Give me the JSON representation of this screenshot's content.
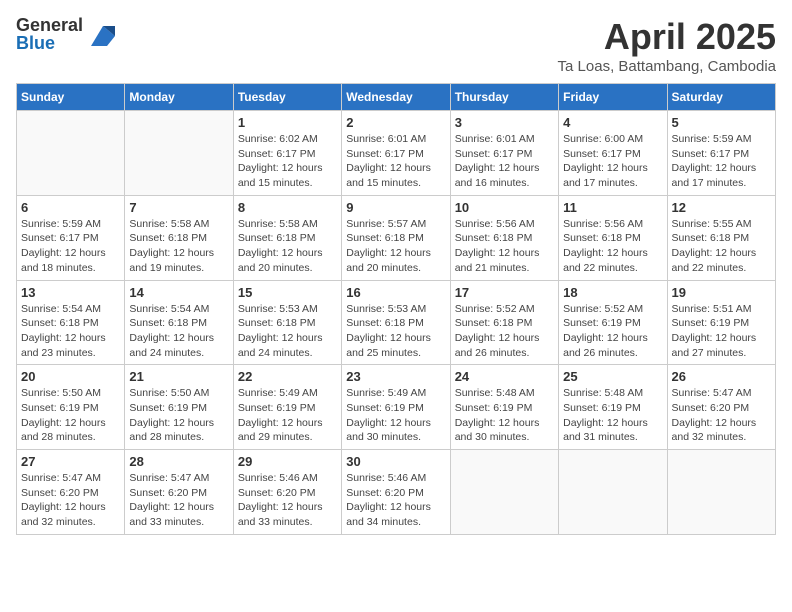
{
  "logo": {
    "general": "General",
    "blue": "Blue"
  },
  "title": {
    "month": "April 2025",
    "location": "Ta Loas, Battambang, Cambodia"
  },
  "weekdays": [
    "Sunday",
    "Monday",
    "Tuesday",
    "Wednesday",
    "Thursday",
    "Friday",
    "Saturday"
  ],
  "weeks": [
    [
      {
        "day": "",
        "info": ""
      },
      {
        "day": "",
        "info": ""
      },
      {
        "day": "1",
        "info": "Sunrise: 6:02 AM\nSunset: 6:17 PM\nDaylight: 12 hours and 15 minutes."
      },
      {
        "day": "2",
        "info": "Sunrise: 6:01 AM\nSunset: 6:17 PM\nDaylight: 12 hours and 15 minutes."
      },
      {
        "day": "3",
        "info": "Sunrise: 6:01 AM\nSunset: 6:17 PM\nDaylight: 12 hours and 16 minutes."
      },
      {
        "day": "4",
        "info": "Sunrise: 6:00 AM\nSunset: 6:17 PM\nDaylight: 12 hours and 17 minutes."
      },
      {
        "day": "5",
        "info": "Sunrise: 5:59 AM\nSunset: 6:17 PM\nDaylight: 12 hours and 17 minutes."
      }
    ],
    [
      {
        "day": "6",
        "info": "Sunrise: 5:59 AM\nSunset: 6:17 PM\nDaylight: 12 hours and 18 minutes."
      },
      {
        "day": "7",
        "info": "Sunrise: 5:58 AM\nSunset: 6:18 PM\nDaylight: 12 hours and 19 minutes."
      },
      {
        "day": "8",
        "info": "Sunrise: 5:58 AM\nSunset: 6:18 PM\nDaylight: 12 hours and 20 minutes."
      },
      {
        "day": "9",
        "info": "Sunrise: 5:57 AM\nSunset: 6:18 PM\nDaylight: 12 hours and 20 minutes."
      },
      {
        "day": "10",
        "info": "Sunrise: 5:56 AM\nSunset: 6:18 PM\nDaylight: 12 hours and 21 minutes."
      },
      {
        "day": "11",
        "info": "Sunrise: 5:56 AM\nSunset: 6:18 PM\nDaylight: 12 hours and 22 minutes."
      },
      {
        "day": "12",
        "info": "Sunrise: 5:55 AM\nSunset: 6:18 PM\nDaylight: 12 hours and 22 minutes."
      }
    ],
    [
      {
        "day": "13",
        "info": "Sunrise: 5:54 AM\nSunset: 6:18 PM\nDaylight: 12 hours and 23 minutes."
      },
      {
        "day": "14",
        "info": "Sunrise: 5:54 AM\nSunset: 6:18 PM\nDaylight: 12 hours and 24 minutes."
      },
      {
        "day": "15",
        "info": "Sunrise: 5:53 AM\nSunset: 6:18 PM\nDaylight: 12 hours and 24 minutes."
      },
      {
        "day": "16",
        "info": "Sunrise: 5:53 AM\nSunset: 6:18 PM\nDaylight: 12 hours and 25 minutes."
      },
      {
        "day": "17",
        "info": "Sunrise: 5:52 AM\nSunset: 6:18 PM\nDaylight: 12 hours and 26 minutes."
      },
      {
        "day": "18",
        "info": "Sunrise: 5:52 AM\nSunset: 6:19 PM\nDaylight: 12 hours and 26 minutes."
      },
      {
        "day": "19",
        "info": "Sunrise: 5:51 AM\nSunset: 6:19 PM\nDaylight: 12 hours and 27 minutes."
      }
    ],
    [
      {
        "day": "20",
        "info": "Sunrise: 5:50 AM\nSunset: 6:19 PM\nDaylight: 12 hours and 28 minutes."
      },
      {
        "day": "21",
        "info": "Sunrise: 5:50 AM\nSunset: 6:19 PM\nDaylight: 12 hours and 28 minutes."
      },
      {
        "day": "22",
        "info": "Sunrise: 5:49 AM\nSunset: 6:19 PM\nDaylight: 12 hours and 29 minutes."
      },
      {
        "day": "23",
        "info": "Sunrise: 5:49 AM\nSunset: 6:19 PM\nDaylight: 12 hours and 30 minutes."
      },
      {
        "day": "24",
        "info": "Sunrise: 5:48 AM\nSunset: 6:19 PM\nDaylight: 12 hours and 30 minutes."
      },
      {
        "day": "25",
        "info": "Sunrise: 5:48 AM\nSunset: 6:19 PM\nDaylight: 12 hours and 31 minutes."
      },
      {
        "day": "26",
        "info": "Sunrise: 5:47 AM\nSunset: 6:20 PM\nDaylight: 12 hours and 32 minutes."
      }
    ],
    [
      {
        "day": "27",
        "info": "Sunrise: 5:47 AM\nSunset: 6:20 PM\nDaylight: 12 hours and 32 minutes."
      },
      {
        "day": "28",
        "info": "Sunrise: 5:47 AM\nSunset: 6:20 PM\nDaylight: 12 hours and 33 minutes."
      },
      {
        "day": "29",
        "info": "Sunrise: 5:46 AM\nSunset: 6:20 PM\nDaylight: 12 hours and 33 minutes."
      },
      {
        "day": "30",
        "info": "Sunrise: 5:46 AM\nSunset: 6:20 PM\nDaylight: 12 hours and 34 minutes."
      },
      {
        "day": "",
        "info": ""
      },
      {
        "day": "",
        "info": ""
      },
      {
        "day": "",
        "info": ""
      }
    ]
  ]
}
